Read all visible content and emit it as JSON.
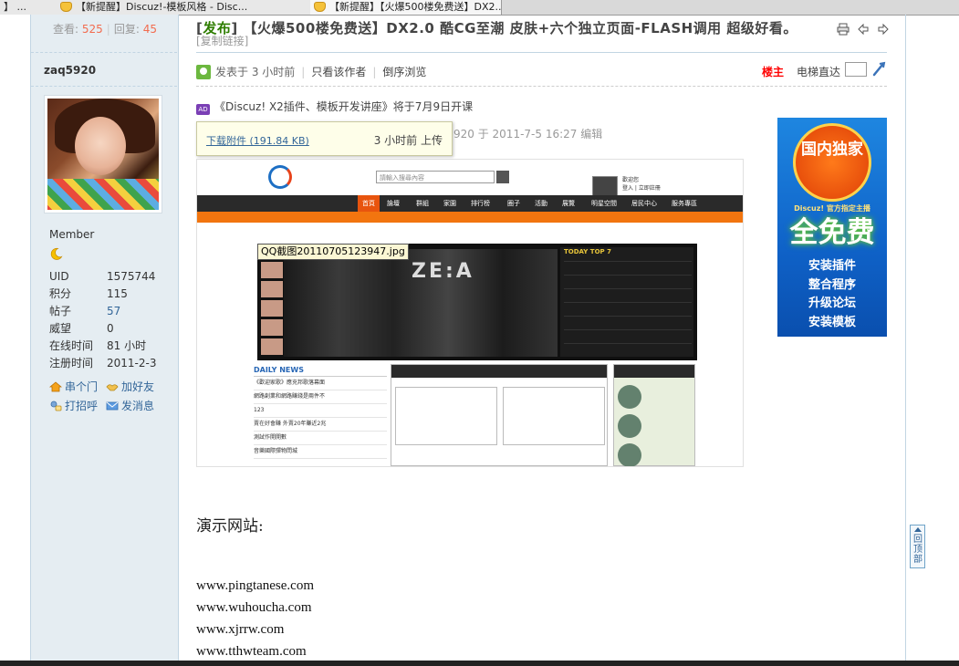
{
  "browser_tabs": [
    {
      "label": "】 ..."
    },
    {
      "label": "【新提醒】Discuz!-模板风格 - Disc..."
    },
    {
      "label": "【新提醒】【火爆500楼免费送】DX2..."
    }
  ],
  "sidebar": {
    "views_label": "查看:",
    "views_value": "525",
    "replies_label": "回复:",
    "replies_value": "45",
    "author": "zaq5920",
    "usergroup": "Member",
    "stats": [
      {
        "label": "UID",
        "value": "1575744"
      },
      {
        "label": "积分",
        "value": "115"
      },
      {
        "label": "帖子",
        "value": "57"
      },
      {
        "label": "威望",
        "value": "0"
      },
      {
        "label": "在线时间",
        "value": "81 小时"
      },
      {
        "label": "注册时间",
        "value": "2011-2-3"
      }
    ],
    "actions": {
      "visit": "串个门",
      "add_friend": "加好友",
      "greet": "打招呼",
      "message": "发消息"
    }
  },
  "thread": {
    "tag": "发布",
    "title": "【火爆500楼免费送】DX2.0 酷CG至潮 皮肤+六个独立页面-FLASH调用 超级好看。",
    "copy_link": "[复制链接]"
  },
  "post": {
    "posted_prefix": "发表于",
    "posted_time": "3 小时前",
    "only_author": "只看该作者",
    "reverse_view": "倒序浏览",
    "owner_badge": "楼主",
    "elevator": "电梯直达",
    "announcement": "《Discuz! X2插件、模板开发讲座》将于7月9日开课",
    "edited_text": "920 于 2011-7-5 16:27 编辑",
    "attachment_link": "下载附件 (191.84 KB)",
    "attachment_time": "3 小时前 上传",
    "image_caption": "QQ截图20110705123947.jpg",
    "demo_label": "演示网站:",
    "demo_sites": [
      "www.pingtanese.com",
      "www.wuhoucha.com",
      "www.xjrrw.com",
      "www.tthwteam.com"
    ]
  },
  "screenshot": {
    "search_placeholder": "請輸入搜尋內容",
    "nav": [
      "首頁",
      "論壇",
      "群組",
      "家園",
      "排行榜",
      "圈子",
      "活動",
      "展覽",
      "明星空間",
      "居民中心",
      "服务專區"
    ],
    "top7_title": "TODAY TOP 7",
    "daily_news": "DAILY NEWS",
    "daily_items": [
      "《歡迎家歌》應充邦歌落幕面",
      "網路創業和網路賺錢是兩件不",
      "123",
      "賣在好會賺 外賣20年賺近2兆",
      "測試作開開數",
      "音樂國際彈物問城"
    ],
    "user_text": [
      "歡迎您",
      "登入 | 立即註冊"
    ],
    "zea_text": "ZE:A"
  },
  "ad": {
    "seal_text": "国内独家",
    "arc_text": "Discuz! 官方指定主播",
    "headline": "全免费",
    "features": [
      "安装插件",
      "整合程序",
      "升级论坛",
      "安装模板"
    ]
  },
  "back_to_top": "回顶部",
  "colors": {
    "sidebar_bg": "#e5edf2",
    "border": "#c2d5e3",
    "link": "#336699",
    "highlight": "#f26c4f",
    "tag_green": "#2e7d00",
    "owner_red": "#ff0000"
  }
}
